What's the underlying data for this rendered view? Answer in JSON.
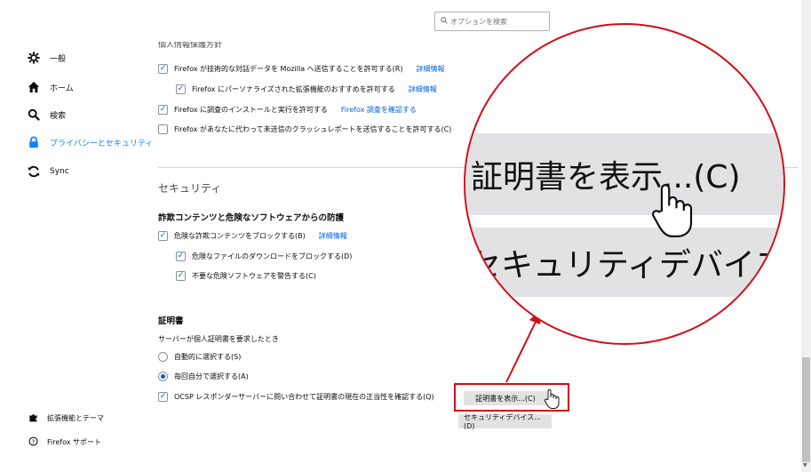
{
  "search": {
    "placeholder": "オプションを検索"
  },
  "sidebar": {
    "items": [
      {
        "label": "一般",
        "icon": "gear-icon"
      },
      {
        "label": "ホーム",
        "icon": "home-icon"
      },
      {
        "label": "検索",
        "icon": "search-icon"
      },
      {
        "label": "プライバシーとセキュリティ",
        "icon": "lock-icon"
      },
      {
        "label": "Sync",
        "icon": "sync-icon"
      }
    ],
    "footer": [
      {
        "label": "拡張機能とテーマ",
        "icon": "puzzle-icon"
      },
      {
        "label": "Firefox サポート",
        "icon": "help-icon"
      }
    ]
  },
  "data_collection": {
    "partial_heading": "個人情報保護方針",
    "options": [
      {
        "label": "Firefox が技術的な対話データを Mozilla へ送信することを許可する(R)",
        "link": "詳細情報",
        "checked": "true"
      },
      {
        "label": "Firefox にパーソナライズされた拡張機能のおすすめを許可する",
        "link": "詳細情報",
        "checked": "true"
      },
      {
        "label": "Firefox に調査のインストールと実行を許可する",
        "link": "Firefox 調査を確認する",
        "checked": "true"
      },
      {
        "label": "Firefox があなたに代わって未送信のクラッシュレポートを送信することを許可する(C)",
        "link": "",
        "checked": "false"
      }
    ]
  },
  "security": {
    "heading": "セキュリティ",
    "subheading": "詐欺コンテンツと危険なソフトウェアからの防護",
    "options": [
      {
        "label": "危険な詐欺コンテンツをブロックする(B)",
        "link": "詳細情報",
        "checked": "true"
      },
      {
        "label": "危険なファイルのダウンロードをブロックする(D)",
        "checked": "true"
      },
      {
        "label": "不要な危険ソフトウェアを警告する(C)",
        "checked": "true"
      }
    ]
  },
  "certificates": {
    "heading": "証明書",
    "prompt": "サーバーが個人証明書を要求したとき",
    "radios": [
      {
        "label": "自動的に選択する(S)",
        "selected": "false"
      },
      {
        "label": "毎回自分で選択する(A)",
        "selected": "true"
      }
    ],
    "ocsp_label": "OCSP レスポンダーサーバーに問い合わせて証明書の現在の正当性を確認する(Q)",
    "view_button": "証明書を表示...(C)",
    "devices_button": "セキュリティデバイス...(D)"
  },
  "zoom": {
    "button1": "証明書を表示...(C)",
    "button2": "セキュリティデバイス...(D)"
  },
  "colors": {
    "accent": "#0060df",
    "active_nav": "#0a84ff",
    "highlight": "#d40b15"
  }
}
